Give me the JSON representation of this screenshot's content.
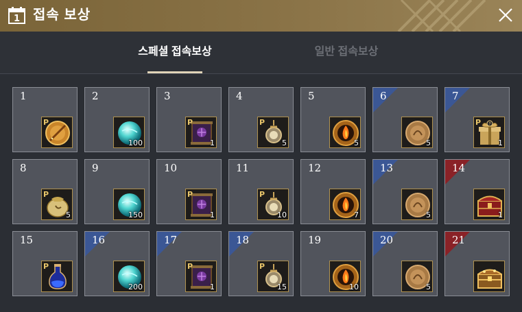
{
  "header": {
    "title": "접속 보상",
    "calendar_digit": "1",
    "icon": "calendar-icon",
    "close_icon": "close-icon"
  },
  "tabs": [
    {
      "label": "스페셜 접속보상",
      "active": true
    },
    {
      "label": "일반 접속보상",
      "active": false
    }
  ],
  "colors": {
    "header": "#8a7347",
    "cell_bg": "#51545c",
    "ribbon_blue": "#3b5795",
    "ribbon_red": "#8a2227",
    "item_border": "#b0924f"
  },
  "rewards": [
    {
      "day": "1",
      "item": "golden-sword-medallion",
      "premium": true,
      "qty": "",
      "ribbon": ""
    },
    {
      "day": "2",
      "item": "cyan-crystal-orb",
      "premium": false,
      "qty": "100",
      "ribbon": ""
    },
    {
      "day": "3",
      "item": "purple-scroll",
      "premium": true,
      "qty": "1",
      "ribbon": ""
    },
    {
      "day": "4",
      "item": "hanging-lantern",
      "premium": true,
      "qty": "5",
      "ribbon": ""
    },
    {
      "day": "5",
      "item": "fire-emblem",
      "premium": false,
      "qty": "5",
      "ribbon": ""
    },
    {
      "day": "6",
      "item": "bronze-coin",
      "premium": false,
      "qty": "5",
      "ribbon": "blue"
    },
    {
      "day": "7",
      "item": "gift-box",
      "premium": true,
      "qty": "1",
      "ribbon": "blue"
    },
    {
      "day": "8",
      "item": "golden-pouch",
      "premium": true,
      "qty": "5",
      "ribbon": ""
    },
    {
      "day": "9",
      "item": "cyan-crystal-orb",
      "premium": false,
      "qty": "150",
      "ribbon": ""
    },
    {
      "day": "10",
      "item": "purple-scroll",
      "premium": true,
      "qty": "1",
      "ribbon": ""
    },
    {
      "day": "11",
      "item": "hanging-lantern",
      "premium": true,
      "qty": "10",
      "ribbon": ""
    },
    {
      "day": "12",
      "item": "fire-emblem",
      "premium": false,
      "qty": "7",
      "ribbon": ""
    },
    {
      "day": "13",
      "item": "bronze-coin",
      "premium": false,
      "qty": "5",
      "ribbon": "blue"
    },
    {
      "day": "14",
      "item": "treasure-chest",
      "premium": false,
      "qty": "1",
      "ribbon": "red"
    },
    {
      "day": "15",
      "item": "potion-flask",
      "premium": true,
      "qty": "",
      "ribbon": ""
    },
    {
      "day": "16",
      "item": "cyan-crystal-orb",
      "premium": false,
      "qty": "200",
      "ribbon": "blue"
    },
    {
      "day": "17",
      "item": "purple-scroll",
      "premium": true,
      "qty": "1",
      "ribbon": "blue"
    },
    {
      "day": "18",
      "item": "hanging-lantern",
      "premium": true,
      "qty": "15",
      "ribbon": "blue"
    },
    {
      "day": "19",
      "item": "fire-emblem",
      "premium": false,
      "qty": "10",
      "ribbon": ""
    },
    {
      "day": "20",
      "item": "bronze-coin",
      "premium": false,
      "qty": "5",
      "ribbon": "blue"
    },
    {
      "day": "21",
      "item": "golden-chest",
      "premium": false,
      "qty": "",
      "ribbon": "red"
    }
  ]
}
